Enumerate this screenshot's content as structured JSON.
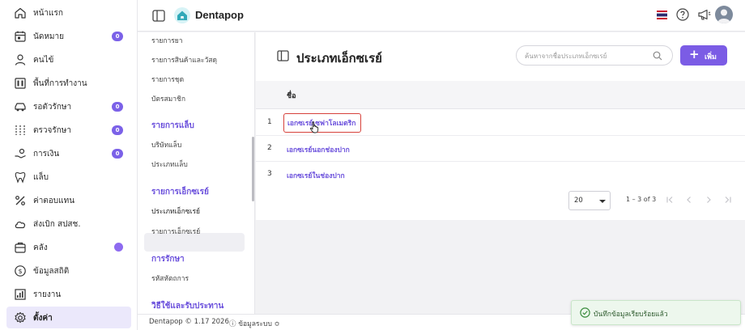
{
  "colors": {
    "accent": "#7b5ce5",
    "badge": "#7b61e8",
    "highlight": "#d6413b",
    "toast_bg": "#edf7ed"
  },
  "sidebar": {
    "items": [
      {
        "label": "หน้าแรก",
        "icon": "home-icon"
      },
      {
        "label": "นัดหมาย",
        "icon": "calendar-icon",
        "badge": "0"
      },
      {
        "label": "คนไข้",
        "icon": "user-icon"
      },
      {
        "label": "พื้นที่การทำงาน",
        "icon": "workspace-icon"
      },
      {
        "label": "รอตัวรักษา",
        "icon": "car-icon",
        "badge": "0"
      },
      {
        "label": "ตรวจรักษา",
        "icon": "treatment-icon",
        "badge": "0"
      },
      {
        "label": "การเงิน",
        "icon": "money-hand-icon",
        "badge": "0"
      },
      {
        "label": "แล็บ",
        "icon": "tooth-icon"
      },
      {
        "label": "ค่าตอบแทน",
        "icon": "percent-icon"
      },
      {
        "label": "ส่งเบิก สปสช.",
        "icon": "cloud-icon"
      },
      {
        "label": "คลัง",
        "icon": "box-icon"
      },
      {
        "label": "ข้อมูลสถิติ",
        "icon": "stats-icon"
      },
      {
        "label": "รายงาน",
        "icon": "report-icon"
      },
      {
        "label": "ตั้งค่า",
        "icon": "gear-icon"
      }
    ]
  },
  "topbar": {
    "brand": "Dentapop"
  },
  "submenu": {
    "links_top": [
      "รายการยา",
      "รายการสินค้าและวัสดุ",
      "รายการชุด",
      "บัตรสมาชิก"
    ],
    "lab_heading": "รายการแล็บ",
    "lab_links": [
      "บริษัทแล็บ",
      "ประเภทแล็บ"
    ],
    "xray_heading": "รายการเอ็กซเรย์",
    "xray_links": [
      "ประเภทเอ็กซเรย์",
      "รายการเอ็กซเรย์"
    ],
    "treat_heading": "การรักษา",
    "treat_links": [
      "รหัสหัตถการ"
    ],
    "payment_heading": "วิธีใช้และรับประทาน"
  },
  "main": {
    "title": "ประเภทเอ็กซเรย์",
    "search_placeholder": "ค้นหาจากชื่อประเภทเอ็กซเรย์",
    "add_label": "เพิ่ม",
    "column_name": "ชื่อ",
    "rows": [
      {
        "num": "1",
        "name": "เอกซเรย์เซฟาโลเมตริก"
      },
      {
        "num": "2",
        "name": "เอกซเรย์นอกช่องปาก"
      },
      {
        "num": "3",
        "name": "เอกซเรย์ในช่องปาก"
      }
    ],
    "page_size": "20",
    "range": "1 – 3 of 3"
  },
  "footer": {
    "copyright": "Dentapop © 1.17 2026",
    "system_info": "ⓘ ข้อมูลระบบ ≎"
  },
  "toast": {
    "message": "บันทึกข้อมูลเรียบร้อยแล้ว"
  }
}
